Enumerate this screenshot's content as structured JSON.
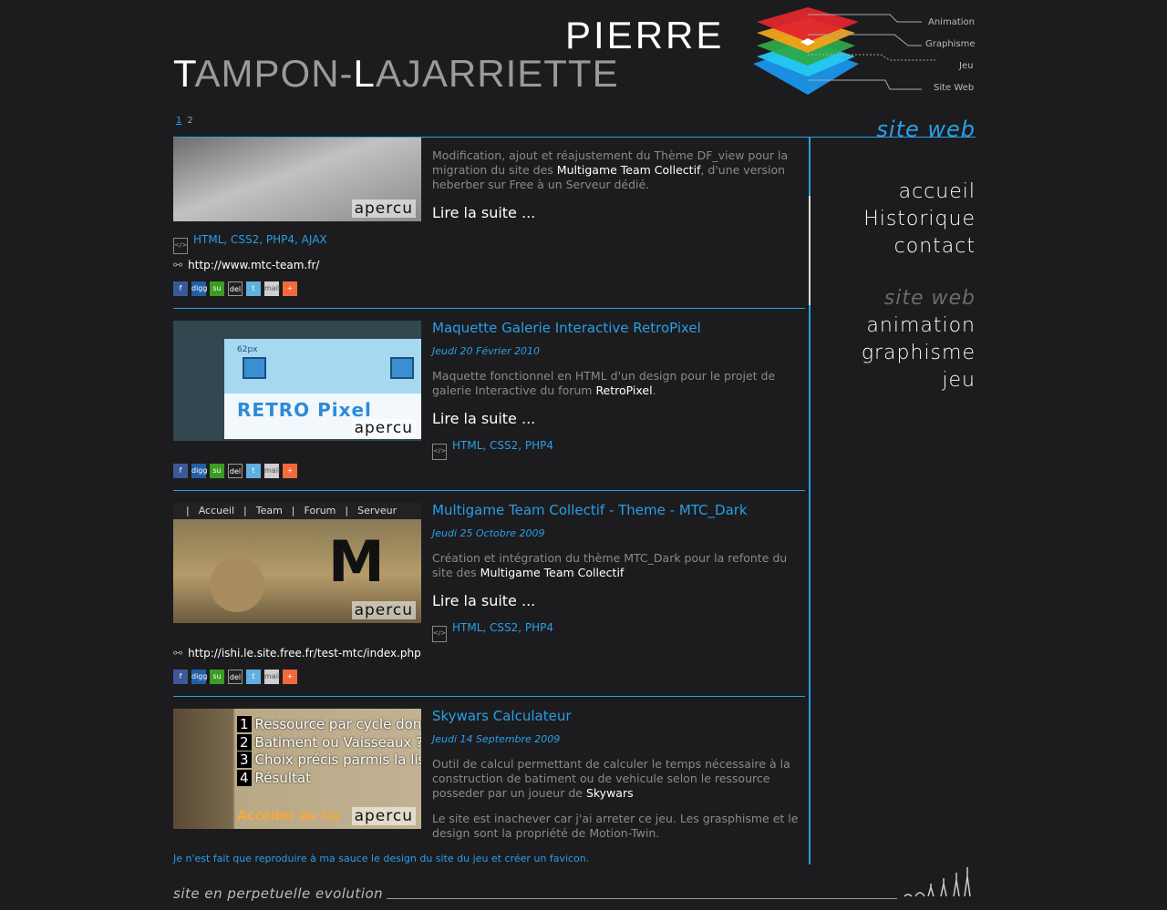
{
  "header": {
    "first_name": "PIERRE",
    "last_name_first": "T",
    "last_name_mid": "AMPON-",
    "last_name_l": "L",
    "last_name_rest": "AJARRIETTE",
    "logo_links": [
      "Animation",
      "Graphisme",
      "Jeu",
      "Site Web"
    ]
  },
  "pager": {
    "pages": [
      "1",
      "2"
    ]
  },
  "section_title": "site web",
  "nav": {
    "main": [
      "accueil",
      "Historique",
      "contact"
    ],
    "sections": [
      "site web",
      "animation",
      "graphisme",
      "jeu"
    ]
  },
  "articles": [
    {
      "desc_a": "Modification, ajout et réajustement du Thème DF_view pour la migration du site des ",
      "desc_b": "Multigame Team Collectif",
      "desc_c": ", d'une version heberber sur Free à un Serveur dédié.",
      "more": "Lire la suite ...",
      "tech": "HTML, CSS2, PHP4, AJAX",
      "url": "http://www.mtc-team.fr/",
      "apercu": "apercu"
    },
    {
      "title": "Maquette Galerie Interactive RetroPixel",
      "date": "Jeudi 20 Février 2010",
      "desc_a": "Maquette fonctionnel en HTML d'un design pour le projet de galerie Interactive du forum ",
      "desc_b": "RetroPixel",
      "desc_c": ".",
      "more": "Lire la suite ...",
      "tech": "HTML, CSS2, PHP4",
      "apercu": "apercu",
      "thumb_text": "RETRO Pixel",
      "thumb_px": "62px"
    },
    {
      "title": "Multigame Team Collectif - Theme - MTC_Dark",
      "date": "Jeudi 25 Octobre 2009",
      "desc_a": "Création et intégration du thème MTC_Dark pour la refonte du site des ",
      "desc_b": "Multigame Team Collectif",
      "desc_c": "",
      "more": "Lire la suite ...",
      "tech": "HTML, CSS2, PHP4",
      "url": "http://ishi.le.site.free.fr/test-mtc/index.php",
      "apercu": "apercu",
      "thumb_menu": [
        "Accueil",
        "Team",
        "Forum",
        "Serveur"
      ]
    },
    {
      "title": "Skywars Calculateur",
      "date": "Jeudi 14 Septembre 2009",
      "desc_a": "Outil de calcul permettant de calculer le temps nécessaire à la construction de batiment ou de vehicule selon le ressource posseder par un joueur de ",
      "desc_b": "Skywars",
      "desc_c": "",
      "desc2": "Le site est inachever car j'ai arreter ce jeu. Les grasphisme et le design sont la propriété de Motion-Twin.",
      "final": "Je n'est fait que reproduire à ma sauce le design du site du jeu et créer un favicon.",
      "apercu": "apercu",
      "thumb_list": [
        "Ressource par cycle dont",
        "Batiment ou Vaisseaux ?",
        "Choix précis parmis la list",
        "Résultat"
      ],
      "thumb_cta": "Accéder au Ca"
    }
  ],
  "share_icons": [
    "f",
    "digg",
    "su",
    "del",
    "t",
    "mail",
    "+"
  ],
  "footer": {
    "text": "site en perpetuelle evolution"
  },
  "colors": {
    "accent": "#2a9ee8",
    "background": "#1c1c1e"
  }
}
